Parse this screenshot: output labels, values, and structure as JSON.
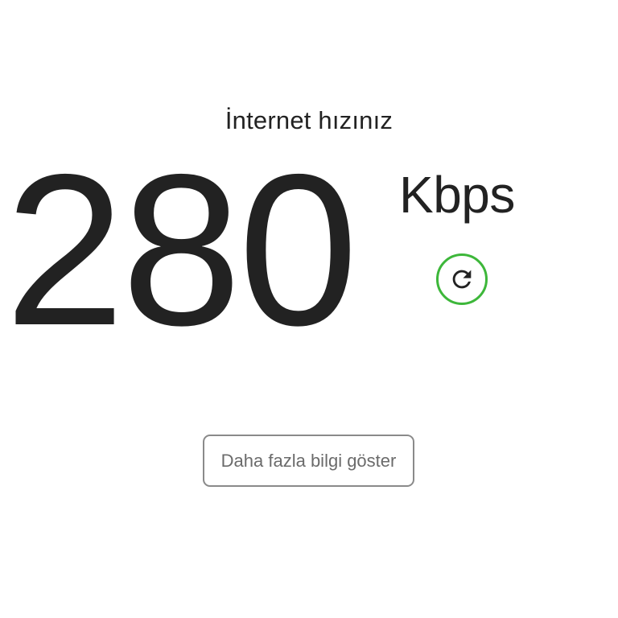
{
  "header": {
    "title": "İnternet hızınız"
  },
  "result": {
    "value": "280",
    "unit": "Kbps"
  },
  "actions": {
    "refresh_icon": "refresh-icon",
    "refresh_color": "#3db73a",
    "more_info_label": "Daha fazla bilgi göster"
  }
}
